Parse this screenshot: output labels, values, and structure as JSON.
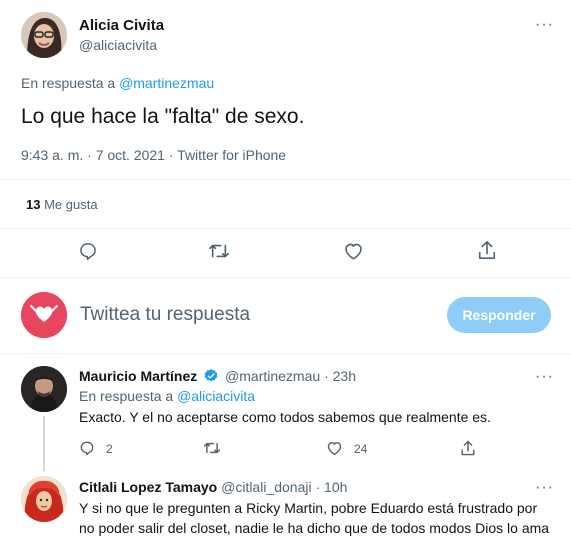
{
  "main_tweet": {
    "author_name": "Alicia Civita",
    "author_handle": "@aliciacivita",
    "reply_prefix": "En respuesta a",
    "reply_to": "@martinezmau",
    "text": "Lo que hace la \"falta\" de sexo.",
    "meta": "9:43 a. m. · 7 oct. 2021 · Twitter for iPhone",
    "likes_count": "13",
    "likes_label": "Me gusta",
    "more": "···"
  },
  "composer": {
    "placeholder": "Twittea tu respuesta",
    "button_label": "Responder"
  },
  "replies": [
    {
      "author_name": "Mauricio Martínez",
      "author_handle": "@martinezmau",
      "separator": "·",
      "time": "23h",
      "reply_prefix": "En respuesta a",
      "reply_to": "@aliciacivita",
      "text": "Exacto. Y el no aceptarse como todos sabemos que realmente es.",
      "reply_count": "2",
      "like_count": "24",
      "verified": true,
      "more": "···"
    },
    {
      "author_name": "Citlali Lopez Tamayo",
      "author_handle": "@citlali_donaji",
      "separator": "·",
      "time": "10h",
      "text_line1": "Y si no que le pregunten a Ricky Martin, pobre Eduardo está frustrado por",
      "text_line2": "no poder salir del closet, nadie le ha dicho que de todos modos Dios lo ama",
      "more": "···"
    }
  ],
  "colors": {
    "accent": "#1d9bf0",
    "button_disabled": "#8ecdf8",
    "text": "#0f1419",
    "muted": "#536471"
  }
}
